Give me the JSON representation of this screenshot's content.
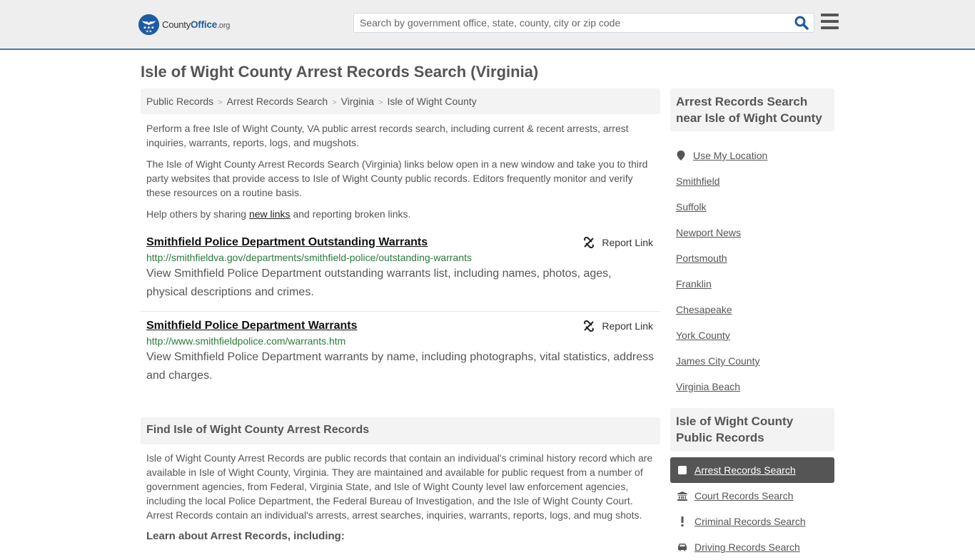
{
  "header": {
    "logo": {
      "name": "County",
      "name_bold": "Office",
      "tld": ".org"
    },
    "search": {
      "placeholder": "Search by government office, state, county, city or zip code",
      "value": ""
    },
    "colors": {
      "brand": "#1f5ba3",
      "header_border": "#3b7cad"
    }
  },
  "page": {
    "title": "Isle of Wight County Arrest Records Search (Virginia)",
    "breadcrumb": [
      "Public Records",
      "Arrest Records Search",
      "Virginia",
      "Isle of Wight County"
    ],
    "intro": {
      "p1": "Perform a free Isle of Wight County, VA public arrest records search, including current & recent arrests, arrest inquiries, warrants, reports, logs, and mugshots.",
      "p2": "The Isle of Wight County Arrest Records Search (Virginia) links below open in a new window and take you to third party websites that provide access to Isle of Wight County public records. Editors frequently monitor and verify these resources on a routine basis.",
      "p3_before": "Help others by sharing ",
      "p3_link": "new links",
      "p3_after": " and reporting broken links."
    },
    "results": [
      {
        "title": "Smithfield Police Department Outstanding Warrants",
        "url": "http://smithfieldva.gov/departments/smithfield-police/outstanding-warrants",
        "description": "View Smithfield Police Department outstanding warrants list, including names, photos, ages, physical descriptions and crimes.",
        "report_label": "Report Link"
      },
      {
        "title": "Smithfield Police Department Warrants",
        "url": "http://www.smithfieldpolice.com/warrants.htm",
        "description": "View Smithfield Police Department warrants by name, including photographs, vital statistics, address and charges.",
        "report_label": "Report Link"
      }
    ],
    "find_section": {
      "heading": "Find Isle of Wight County Arrest Records",
      "body": "Isle of Wight County Arrest Records are public records that contain an individual's criminal history record which are available in Isle of Wight County, Virginia. They are maintained and available for public request from a number of government agencies, from Federal, Virginia State, and Isle of Wight County level law enforcement agencies, including the local Police Department, the Federal Bureau of Investigation, and the Isle of Wight County Court. Arrest Records contain an individual's arrests, arrest searches, inquiries, warrants, reports, logs, and mug shots.",
      "subheading": "Learn about Arrest Records, including:"
    }
  },
  "sidebar": {
    "nearby": {
      "heading": "Arrest Records Search near Isle of Wight County",
      "use_location": "Use My Location",
      "places": [
        "Smithfield",
        "Suffolk",
        "Newport News",
        "Portsmouth",
        "Franklin",
        "Chesapeake",
        "York County",
        "James City County",
        "Virginia Beach"
      ]
    },
    "public_records": {
      "heading": "Isle of Wight County Public Records",
      "items": [
        {
          "label": "Arrest Records Search",
          "icon": "square-icon",
          "active": true
        },
        {
          "label": "Court Records Search",
          "icon": "courthouse-icon",
          "active": false
        },
        {
          "label": "Criminal Records Search",
          "icon": "exclamation-icon",
          "active": false
        },
        {
          "label": "Driving Records Search",
          "icon": "car-icon",
          "active": false
        }
      ]
    }
  }
}
